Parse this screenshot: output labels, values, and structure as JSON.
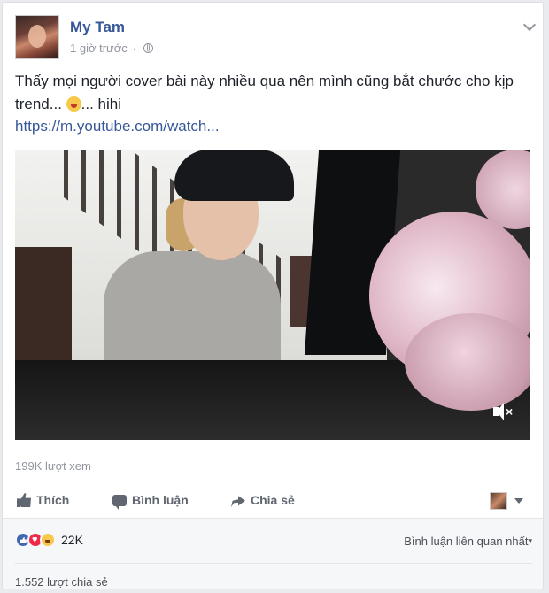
{
  "post": {
    "author": "My Tam",
    "time": "1 giờ trước",
    "text_main": "Thấy mọi người cover bài này nhiều qua nên mình cũng bắt chước cho kịp trend...",
    "text_tail": "... hihi",
    "link": "https://m.youtube.com/watch..."
  },
  "video": {
    "views": "199K lượt xem"
  },
  "actions": {
    "like": "Thích",
    "comment": "Bình luận",
    "share": "Chia sẻ"
  },
  "reactions": {
    "count": "22K",
    "sort_label": "Bình luận liên quan nhất"
  },
  "shares_label": "1.552 lượt chia sẻ",
  "icons": [
    "globe-icon",
    "chevron-down-icon",
    "mute-icon",
    "like-icon",
    "comment-icon",
    "share-icon",
    "haha-emoji-icon",
    "like-reaction-icon",
    "love-reaction-icon",
    "haha-reaction-icon"
  ]
}
